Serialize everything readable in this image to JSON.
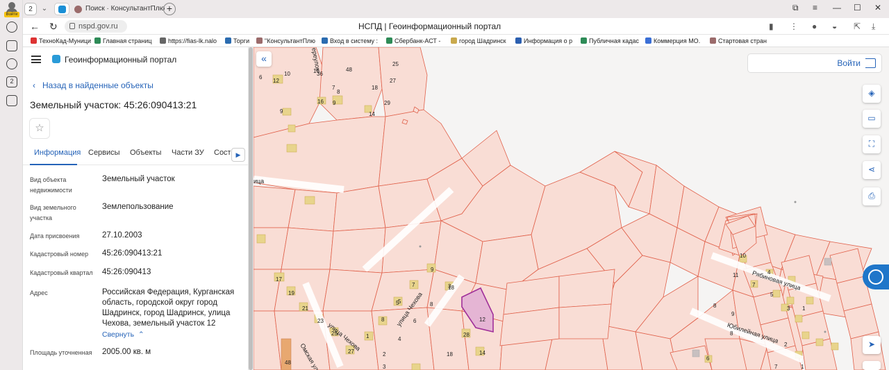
{
  "browser": {
    "tab_count": "2",
    "tab2_title": "Поиск · КонсультантПлю",
    "avatar_tag": "Войти",
    "url": "nspd.gov.ru",
    "page_title": "НСПД | Геоинформационный портал",
    "left_badge": "2"
  },
  "bookmarks": [
    {
      "label": "ТехноКад-Муници",
      "color": "#d33"
    },
    {
      "label": "Главная страниц",
      "color": "#2e8b57"
    },
    {
      "label": "https://fias-lk.nalo",
      "color": "#666"
    },
    {
      "label": "Торги",
      "color": "#2b6cb0"
    },
    {
      "label": "\"КонсультантПлю",
      "color": "#9b6b6b"
    },
    {
      "label": "Вход в систему :",
      "color": "#2b6cb0"
    },
    {
      "label": "Сбербанк-АСТ -",
      "color": "#2e8b57"
    },
    {
      "label": "город Шадринск",
      "color": "#c9a94d"
    },
    {
      "label": "Информация о р",
      "color": "#2b5fb0"
    },
    {
      "label": "Публичная кадас",
      "color": "#2e8b57"
    },
    {
      "label": "Коммерция МО.",
      "color": "#3b6fd6"
    },
    {
      "label": "Стартовая стран",
      "color": "#9b6b6b"
    }
  ],
  "panel": {
    "portal_name": "Геоинформационный портал",
    "back_link": "Назад в найденные объекты",
    "title": "Земельный участок: 45:26:090413:21",
    "tabs": [
      "Информация",
      "Сервисы",
      "Объекты",
      "Части ЗУ",
      "Соста"
    ],
    "properties": [
      {
        "label": "Вид объекта недвижимости",
        "value": "Земельный участок"
      },
      {
        "label": "Вид земельного участка",
        "value": "Землепользование"
      },
      {
        "label": "Дата присвоения",
        "value": "27.10.2003"
      },
      {
        "label": "Кадастровый номер",
        "value": "45:26:090413:21"
      },
      {
        "label": "Кадастровый квартал",
        "value": "45:26:090413"
      },
      {
        "label": "Адрес",
        "value": "Российская Федерация, Курганская область, городской округ город Шадринск, город Шадринск, улица Чехова, земельный участок 12"
      },
      {
        "label": "Площадь уточненная",
        "value": "2005.00 кв. м"
      }
    ],
    "collapse_link": "Свернуть"
  },
  "map": {
    "login_label": "Войти",
    "street_labels": [
      "улица Чехова",
      "улица Чехова",
      "Омская ули",
      "Рябиновая улица",
      "Юбилейная улица",
      "ереулок",
      "ица"
    ],
    "parcel_numbers": [
      "36",
      "16",
      "48",
      "25",
      "12",
      "10",
      "6",
      "7",
      "18",
      "27",
      "9",
      "16",
      "9",
      "14",
      "29",
      "8",
      "7",
      "9",
      "5",
      "8",
      "8",
      "3",
      "5",
      "18",
      "17",
      "19",
      "21",
      "23",
      "25",
      "27",
      "2",
      "1",
      "4",
      "6",
      "28",
      "14",
      "18",
      "3",
      "12",
      "10",
      "11",
      "7",
      "4",
      "5",
      "3",
      "1",
      "8",
      "9",
      "2",
      "8",
      "6",
      "7",
      "1",
      "48"
    ],
    "colors": {
      "parcel_fill": "#f9ddd5",
      "parcel_stroke": "#e0604a",
      "building": "#e8d48c",
      "selected_fill": "#e5b5d4",
      "selected_stroke": "#a0309a"
    }
  }
}
